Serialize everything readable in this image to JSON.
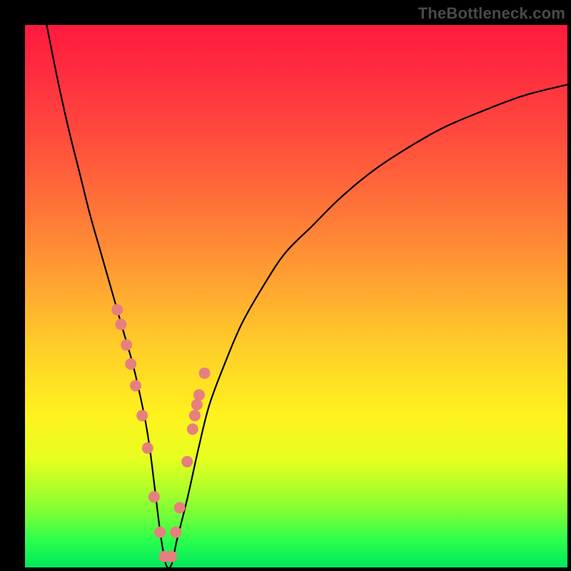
{
  "watermark": {
    "text": "TheBottleneck.com"
  },
  "colors": {
    "frame": "#000000",
    "curve_stroke": "#000000",
    "marker_fill": "#e77f7f",
    "marker_stroke": "#c45e5e",
    "gradient_stops": [
      "#ff1a3e",
      "#ff4a3d",
      "#ffa531",
      "#fff21e",
      "#6bff3a",
      "#00e85c"
    ]
  },
  "chart_data": {
    "type": "line",
    "title": "",
    "xlabel": "",
    "ylabel": "",
    "xlim": [
      0,
      100
    ],
    "ylim": [
      0,
      100
    ],
    "grid": false,
    "legend": false,
    "annotations": [],
    "series": [
      {
        "name": "bottleneck-curve",
        "x": [
          4,
          6,
          8,
          10,
          12,
          14,
          16,
          18,
          20,
          22,
          23,
          24,
          25,
          26,
          27,
          28,
          30,
          32,
          34,
          37,
          40,
          44,
          48,
          53,
          58,
          64,
          70,
          77,
          84,
          92,
          100
        ],
        "y": [
          100,
          90,
          81,
          73,
          65,
          58,
          51,
          44,
          37,
          28,
          22,
          14,
          6,
          0.5,
          0.5,
          5,
          13,
          22,
          30,
          38,
          45,
          52,
          58,
          63,
          68,
          73,
          77,
          81,
          84,
          87,
          89
        ]
      }
    ],
    "markers": {
      "name": "highlighted-points",
      "x": [
        17.0,
        17.7,
        18.7,
        19.5,
        20.4,
        21.6,
        22.6,
        23.8,
        24.9,
        25.7,
        27.0,
        27.8,
        28.5,
        29.9,
        30.9,
        31.3,
        31.7,
        32.1,
        33.1
      ],
      "y": [
        47.5,
        44.8,
        41.0,
        37.5,
        33.5,
        28.0,
        22.0,
        13.0,
        6.5,
        2.0,
        2.0,
        6.5,
        11.0,
        19.5,
        25.5,
        28.0,
        30.0,
        31.8,
        35.8
      ]
    }
  }
}
